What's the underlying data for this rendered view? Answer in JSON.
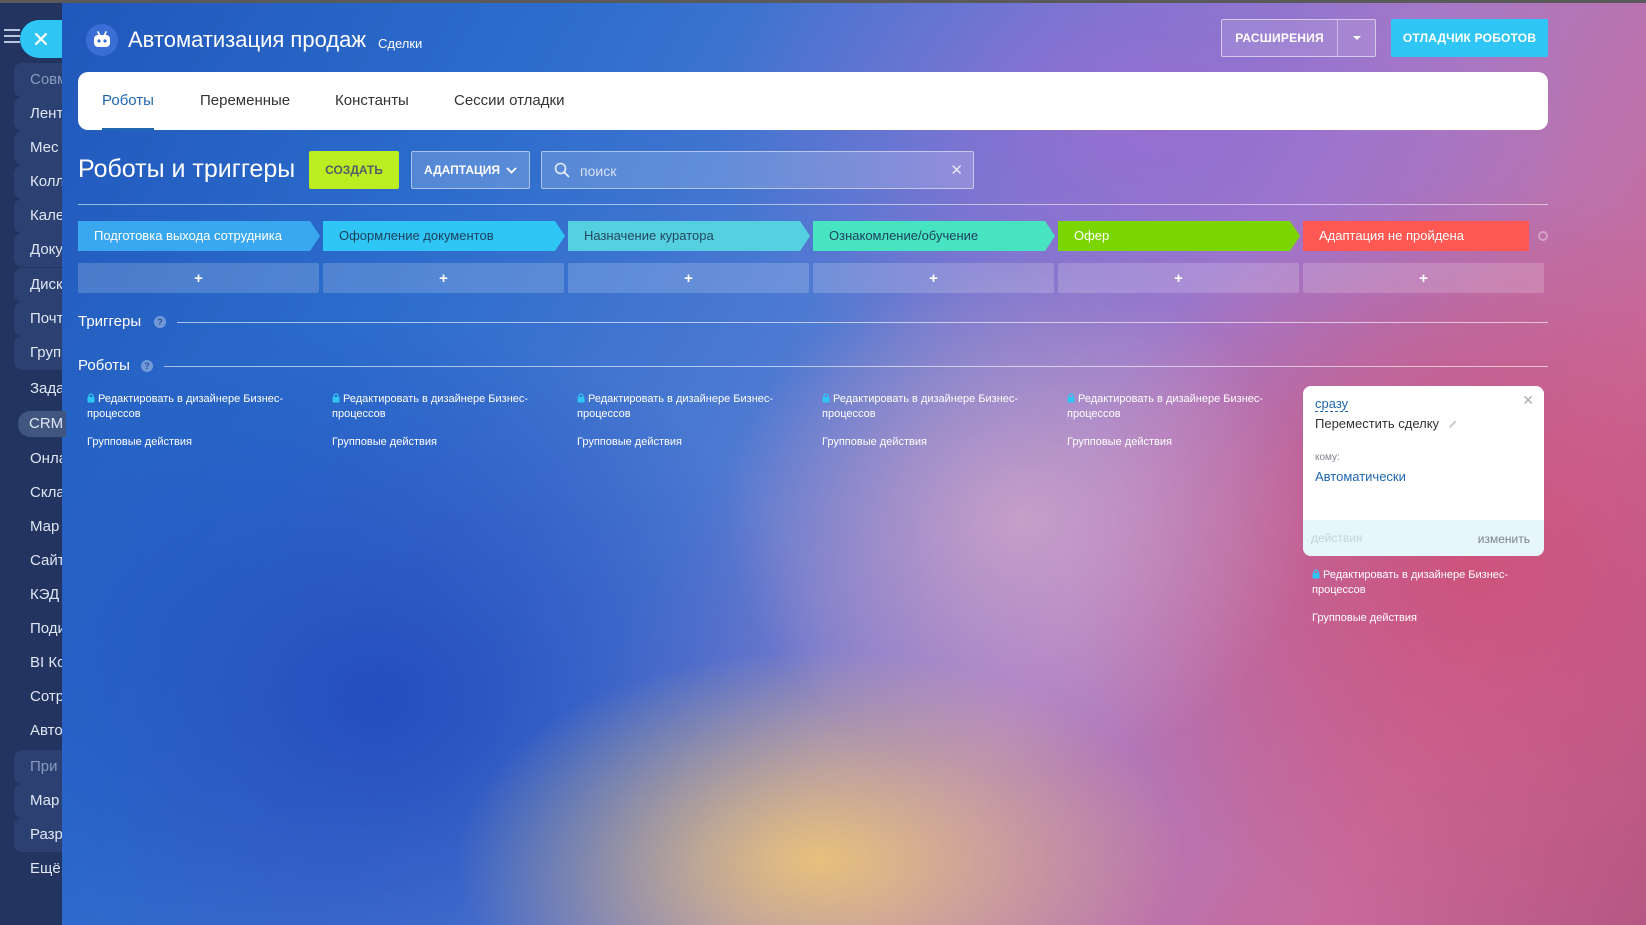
{
  "header": {
    "title": "Автоматизация продаж",
    "subtitle": "Сделки",
    "extensions_label": "РАСШИРЕНИЯ",
    "debugger_label": "ОТЛАДЧИК РОБОТОВ"
  },
  "sidebar": {
    "items": [
      "Совм",
      "Лент",
      "Мес",
      "Колл",
      "Кале",
      "Доку",
      "Диск",
      "Почт",
      "Груп",
      "Зада",
      "CRM",
      "Онла",
      "Скла",
      "Мар",
      "Сайт",
      "КЭД",
      "Поди",
      "BI Ко",
      "Сотр",
      "Авто",
      "При",
      "Мар",
      "Разр",
      "Ещё"
    ]
  },
  "tabs": [
    "Роботы",
    "Переменные",
    "Константы",
    "Сессии отладки"
  ],
  "toolbar": {
    "page_title": "Роботы и триггеры",
    "create_label": "СОЗДАТЬ",
    "pipeline_label": "АДАПТАЦИЯ",
    "search_placeholder": "поиск"
  },
  "stages": [
    {
      "name": "Подготовка выхода сотрудника",
      "color": "#39a8ef"
    },
    {
      "name": "Оформление документов",
      "color": "#2fc6f6"
    },
    {
      "name": "Назначение куратора",
      "color": "#55d0e0"
    },
    {
      "name": "Ознакомление/обучение",
      "color": "#47e4c2"
    },
    {
      "name": "Офер",
      "color": "#7bd500"
    },
    {
      "name": "Адаптация не пройдена",
      "color": "#ff5752"
    }
  ],
  "add_symbol": "+",
  "sections": {
    "triggers": "Триггеры",
    "robots": "Роботы",
    "help": "?"
  },
  "robot_column": {
    "edit_link": "Редактировать в дизайнере Бизнес-процессов",
    "group_actions": "Групповые действия"
  },
  "robot_card": {
    "when": "сразу",
    "title": "Переместить сделку",
    "to_label": "кому:",
    "to_value": "Автоматически",
    "footer_ghost": "действия",
    "edit_label": "изменить"
  }
}
